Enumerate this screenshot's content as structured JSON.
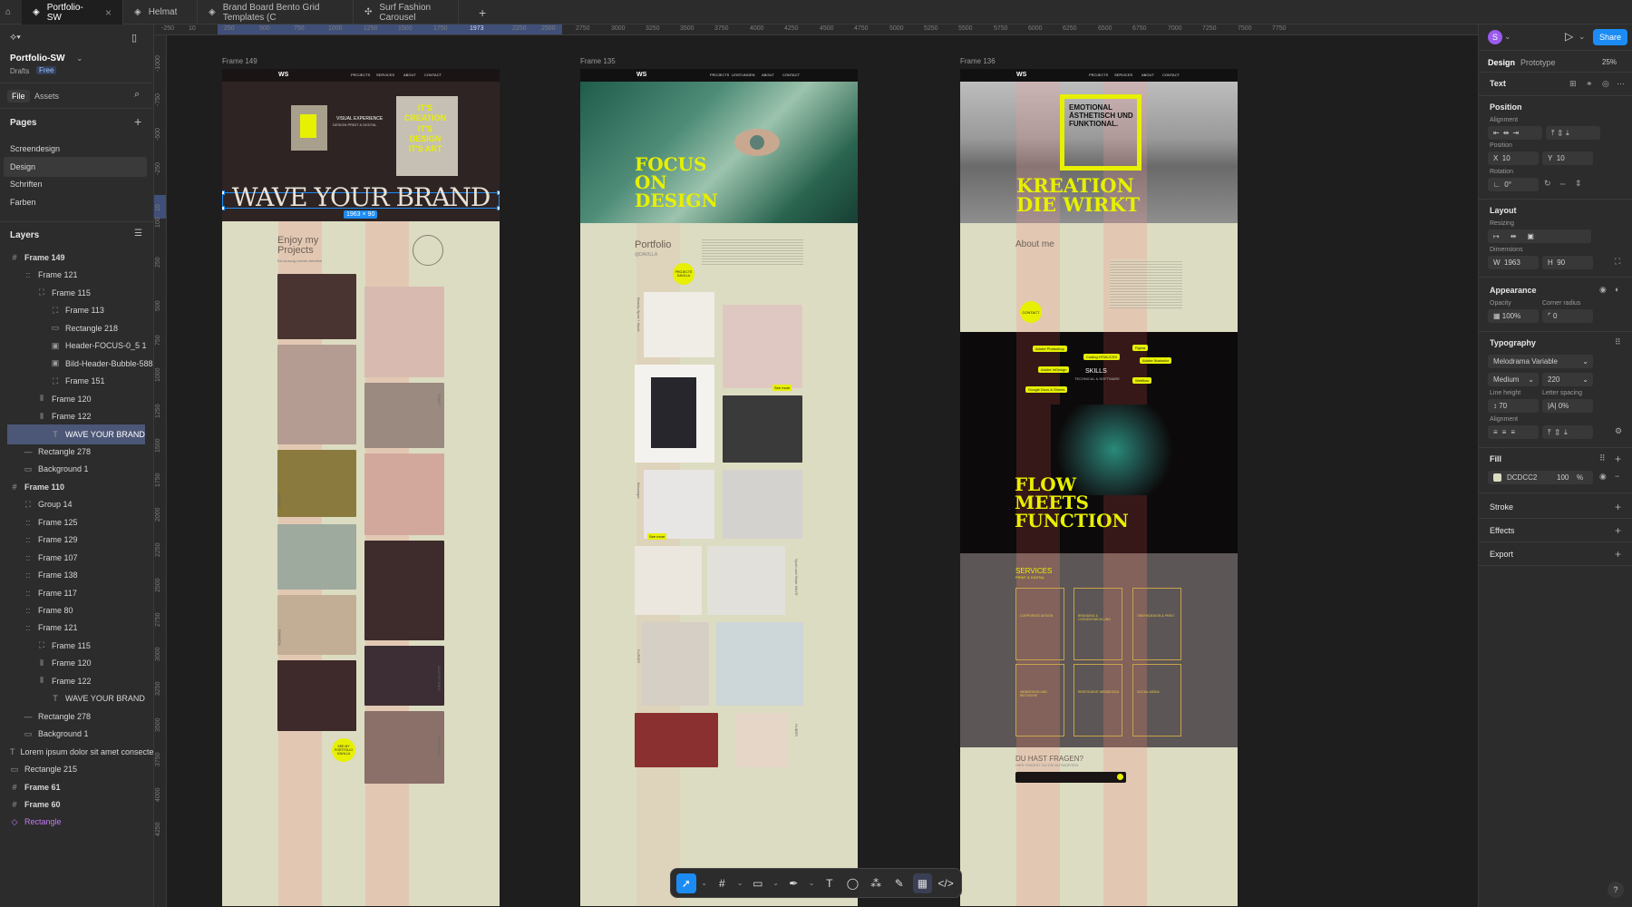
{
  "tabs": [
    {
      "label": "Portfolio-SW",
      "active": true
    },
    {
      "label": "Helmat"
    },
    {
      "label": "Brand Board Bento Grid Templates (C"
    },
    {
      "label": "Surf Fashion Carousel"
    }
  ],
  "file": {
    "name": "Portfolio-SW",
    "location": "Drafts",
    "plan": "Free"
  },
  "left_tabs": {
    "file": "File",
    "assets": "Assets"
  },
  "pages": {
    "title": "Pages",
    "items": [
      "Screendesign",
      "Design",
      "Schriften",
      "Farben"
    ]
  },
  "layers": {
    "title": "Layers",
    "items": [
      {
        "label": "Frame 149",
        "icon": "#"
      },
      {
        "label": "Frame 121",
        "icon": "::"
      },
      {
        "label": "Frame 115",
        "icon": "⛶"
      },
      {
        "label": "Frame 113",
        "icon": "⛶"
      },
      {
        "label": "Rectangle 218",
        "icon": "▭"
      },
      {
        "label": "Header-FOCUS-0_5 1",
        "icon": "▣"
      },
      {
        "label": "Bild-Header-Bubble-588",
        "icon": "▣"
      },
      {
        "label": "Frame 151",
        "icon": "⛶"
      },
      {
        "label": "Frame 120",
        "icon": "⫴"
      },
      {
        "label": "Frame 122",
        "icon": "⫴"
      },
      {
        "label": "WAVE YOUR BRAND",
        "icon": "T"
      },
      {
        "label": "Rectangle 278",
        "icon": "—"
      },
      {
        "label": "Background 1",
        "icon": "▭"
      },
      {
        "label": "Frame 110",
        "icon": "#"
      },
      {
        "label": "Group 14",
        "icon": "⛶"
      },
      {
        "label": "Frame 125",
        "icon": "::"
      },
      {
        "label": "Frame 129",
        "icon": "::"
      },
      {
        "label": "Frame 107",
        "icon": "::"
      },
      {
        "label": "Frame 138",
        "icon": "::"
      },
      {
        "label": "Frame 117",
        "icon": "::"
      },
      {
        "label": "Frame 80",
        "icon": "::"
      },
      {
        "label": "Frame 121",
        "icon": "::"
      },
      {
        "label": "Frame 115",
        "icon": "⛶"
      },
      {
        "label": "Frame 120",
        "icon": "⫴"
      },
      {
        "label": "Frame 122",
        "icon": "⫴"
      },
      {
        "label": "WAVE YOUR BRAND",
        "icon": "T"
      },
      {
        "label": "Rectangle 278",
        "icon": "—"
      },
      {
        "label": "Background 1",
        "icon": "▭"
      },
      {
        "label": "Lorem ipsum dolor sit amet consectetur",
        "icon": "T"
      },
      {
        "label": "Rectangle 215",
        "icon": "▭"
      },
      {
        "label": "Frame 61",
        "icon": "#"
      },
      {
        "label": "Frame 60",
        "icon": "#"
      },
      {
        "label": "Rectangle",
        "icon": "◇"
      }
    ]
  },
  "ruler_top": [
    "-250",
    "10",
    "250",
    "500",
    "750",
    "1000",
    "1250",
    "1500",
    "1750",
    "1973",
    "2250",
    "2500",
    "2750",
    "3000",
    "3250",
    "3500",
    "3750",
    "4000",
    "4250",
    "4500",
    "4750",
    "5000",
    "5250",
    "5500",
    "5750",
    "6000",
    "6250",
    "6500",
    "6750",
    "7000",
    "7250",
    "7500",
    "7750"
  ],
  "ruler_left": [
    "-1000",
    "-750",
    "-500",
    "-250",
    "10",
    "100",
    "250",
    "500",
    "750",
    "1000",
    "1250",
    "1500",
    "1750",
    "2000",
    "2250",
    "2500",
    "2750",
    "3000",
    "3250",
    "3500",
    "3750",
    "4000",
    "4250"
  ],
  "frames": {
    "f149": {
      "label": "Frame 149",
      "nav": [
        "PROJECTS",
        "SERVICES",
        "ABOUT",
        "CONTACT"
      ],
      "visual_line1": "VISUAL EXPERIENCE",
      "visual_line2": "DESIGN PRINT & DIGITAL",
      "poster_text": "IT'S CREATION IT'S DESIGN IT'S ART",
      "headline": "WAVE YOUR BRAND",
      "size_badge": "1963 × 90",
      "enjoy_title": "Enjoy my Projects",
      "enjoy_sub": "Ein Auszug meiner Arbeiten",
      "side_labels": [
        "CRAFT",
        "HEALTH",
        "FASHION",
        "ADVENTURES",
        "BEVERAGE"
      ],
      "cta": "SEE MY PORTFOLIO DAVILLA"
    },
    "f135": {
      "label": "Frame 135",
      "nav": [
        "PROJECTS",
        "LEISTUNGEN",
        "ABOUT",
        "CONTACT"
      ],
      "headline": "FOCUS ON DESIGN",
      "portfolio": "Portfolio",
      "portfolio_sub": "@DAVILLA",
      "badge": "PROJECTS DAVILLA",
      "side_labels": [
        "Beauty Sport + Mode",
        "Bessinger",
        "Sport und Mode MAYE",
        "KURIER",
        "HUBER"
      ],
      "see_more": "See more"
    },
    "f136": {
      "label": "Frame 136",
      "nav": [
        "PROJECTS",
        "SERVICES",
        "ABOUT",
        "CONTACT"
      ],
      "emotional": "EMOTIONAL ÄSTHETISCH UND FUNKTIONAL.",
      "headline": "KREATION DIE WIRKT",
      "about": "About me",
      "contact_btn": "CONTACT",
      "skills_title": "SKILLS",
      "skills_sub": "TECHNICAL & SOFTWARE",
      "skill_tags": [
        "Adobe Photoshop",
        "Coding HTML/CSS",
        "Figma",
        "Adobe Illustrator",
        "Adobe InDesign",
        "Webflow",
        "Google Docs & Sheets"
      ],
      "flow": "FLOW MEETS FUNCTION",
      "services": "SERVICES",
      "services_sub": "PRINT & DIGITAL",
      "service_items": [
        "CORPORATE DESIGN",
        "BRANDING & LOGOENTWICKLUNG",
        "GRAFIKDESIGN & PRINT",
        "WEBDESIGN UND RETUSCHE",
        "RESPONSIVE WEBDESIGN",
        "SOCIAL MEDIA"
      ],
      "faq": "DU HAST FRAGEN?",
      "faq_sub": "HIER FINDEST DU DIE ANTWORTEN"
    }
  },
  "right_panel": {
    "tabs": {
      "design": "Design",
      "prototype": "Prototype"
    },
    "zoom": "25%",
    "share": "Share",
    "avatar": "S",
    "element_type": "Text",
    "position": {
      "title": "Position",
      "alignment": "Alignment",
      "position_label": "Position",
      "x": "10",
      "y": "10",
      "rotation_label": "Rotation",
      "rotation": "0°"
    },
    "layout": {
      "title": "Layout",
      "resizing": "Resizing",
      "dimensions": "Dimensions",
      "w": "1963",
      "h": "90"
    },
    "appearance": {
      "title": "Appearance",
      "opacity_label": "Opacity",
      "opacity": "100%",
      "radius_label": "Corner radius",
      "radius": "0"
    },
    "typography": {
      "title": "Typography",
      "font": "Melodrama Variable",
      "weight": "Medium",
      "size": "220",
      "line_height_label": "Line height",
      "line_height": "70",
      "letter_spacing_label": "Letter spacing",
      "letter_spacing": "0%",
      "alignment": "Alignment"
    },
    "fill": {
      "title": "Fill",
      "hex": "DCDCC2",
      "opacity": "100",
      "unit": "%",
      "color": "#DCDCC2"
    },
    "stroke": "Stroke",
    "effects": "Effects",
    "export": "Export",
    "help": "?"
  },
  "colors": {
    "accent": "#1c8cf4",
    "lime": "#e7f000",
    "beige": "#dcdcc2",
    "selection": "#4c5777"
  }
}
